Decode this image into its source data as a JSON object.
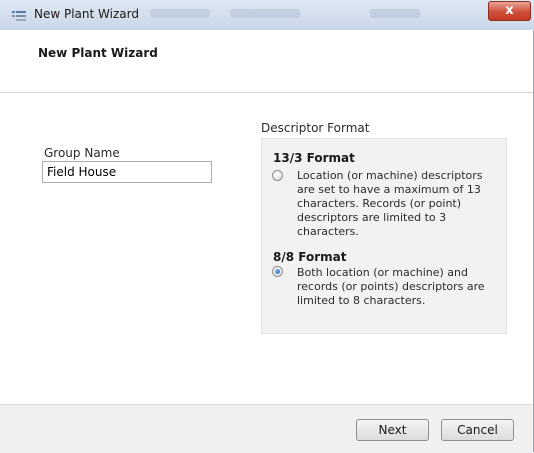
{
  "window": {
    "title": "New Plant Wizard",
    "close_label": "x"
  },
  "header": {
    "title": "New Plant Wizard"
  },
  "group": {
    "label": "Group Name",
    "value": "Field House"
  },
  "descriptor": {
    "heading": "Descriptor Format",
    "options": [
      {
        "title": "13/3 Format",
        "description": "Location (or machine) descriptors are set to have a maximum of 13 characters.  Records (or point) descriptors are limited  to 3 characters.",
        "selected": false
      },
      {
        "title": "8/8 Format",
        "description": "Both location (or machine) and records (or points) descriptors are limited to 8 characters.",
        "selected": true
      }
    ]
  },
  "buttons": {
    "next_label": "Next",
    "cancel_label": "Cancel"
  }
}
